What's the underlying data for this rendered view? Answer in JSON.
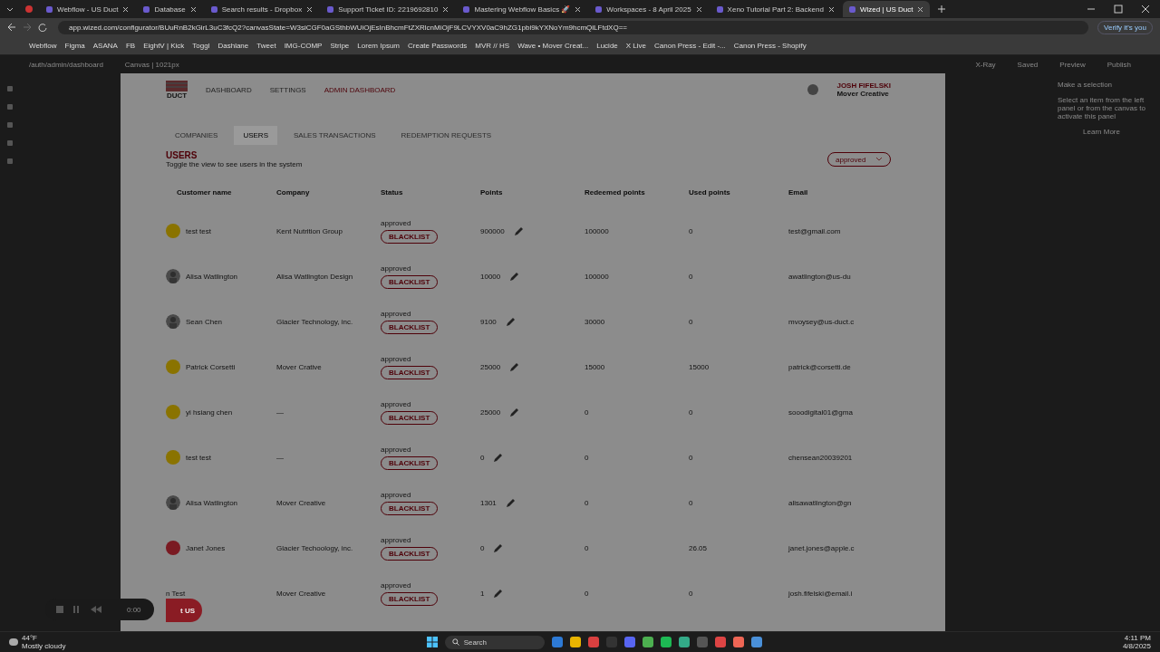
{
  "browser": {
    "tabs": [
      {
        "title": "Webflow - US Duct",
        "selected": false
      },
      {
        "title": "Database",
        "selected": false
      },
      {
        "title": "Search results - Dropbox",
        "selected": false
      },
      {
        "title": "Support Ticket ID: 2219692810",
        "selected": false
      },
      {
        "title": "Mastering Webflow Basics 🚀",
        "selected": false
      },
      {
        "title": "Workspaces - 8 April 2025",
        "selected": false
      },
      {
        "title": "Xeno Tutorial Part 2: Backend",
        "selected": false
      },
      {
        "title": "Wized | US Duct",
        "selected": true
      }
    ],
    "url": "app.wized.com/configurator/BUuRnB2kGirL3uC3fcQ2?canvasState=W3siCGF0aGSthbWUiOjEsInBhcmFtZXRlcnMiOjF9LCVYXV0aC9hZG1pbi9kYXNoYm9hcmQiLFtdXQ==",
    "profile": "Verify it's you",
    "bookmarks": [
      "Webflow",
      "Figma",
      "ASANA",
      "FB",
      "EightV | Kick",
      "Toggl",
      "Dashlane",
      "Tweet",
      "IMG-COMP",
      "Stripe",
      "Lorem Ipsum",
      "Create Passwords",
      "MVR // HS",
      "Wave • Mover Creat...",
      "Lucide",
      "X Live",
      "Canon Press - Edit -...",
      "Canon Press - Shopify"
    ]
  },
  "editor": {
    "path": "/auth/admin/dashboard",
    "canvas_size": "Canvas | 1021px",
    "actions": [
      "X-Ray",
      "Saved",
      "Preview",
      "Publish"
    ],
    "panel": {
      "title": "Make a selection",
      "text": "Select an item from the left panel or from the canvas to activate this panel",
      "link": "Learn More"
    }
  },
  "app": {
    "logo": "DUCT",
    "nav": [
      {
        "label": "DASHBOARD",
        "selected": false
      },
      {
        "label": "SETTINGS",
        "selected": false
      },
      {
        "label": "ADMIN DASHBOARD",
        "selected": true
      }
    ],
    "user": {
      "name": "JOSH FIFELSKI",
      "company": "Mover Creative"
    },
    "tabs": [
      {
        "label": "COMPANIES",
        "selected": false
      },
      {
        "label": "USERS",
        "selected": true
      },
      {
        "label": "SALES TRANSACTIONS",
        "selected": false
      },
      {
        "label": "REDEMPTION REQUESTS",
        "selected": false
      }
    ],
    "title": "USERS",
    "subtitle": "Toggle the view to see users in the system",
    "filter": "approved",
    "columns": [
      "Customer name",
      "Company",
      "Status",
      "Points",
      "Redeemed points",
      "Used points",
      "Email"
    ],
    "rows": [
      {
        "avatar": {
          "kind": "dot",
          "color": "#8a7300"
        },
        "name": "test test",
        "company": "Kent Nutrition Group",
        "status": "approved",
        "action": "BLACKLIST",
        "points": "900000",
        "redeemed": "100000",
        "used": "0",
        "email": "test@gmail.com"
      },
      {
        "name": "Alisa Watlington",
        "company": "Alisa Watlington Design",
        "status": "approved",
        "action": "BLACKLIST",
        "points": "10000",
        "redeemed": "100000",
        "used": "0",
        "email": "awatlington@us-du"
      },
      {
        "name": "Sean Chen",
        "company": "Glacier Technology, inc.",
        "status": "approved",
        "action": "BLACKLIST",
        "points": "9100",
        "redeemed": "30000",
        "used": "0",
        "email": "mvoysey@us-duct.c"
      },
      {
        "avatar": {
          "kind": "dot",
          "color": "#8a7300"
        },
        "name": "Patrick Corsetti",
        "company": "Mover Crative",
        "status": "approved",
        "action": "BLACKLIST",
        "points": "25000",
        "redeemed": "15000",
        "used": "15000",
        "email": "patrick@corsetti.de"
      },
      {
        "avatar": {
          "kind": "dot",
          "color": "#8a7300"
        },
        "name": "yi hsiang chen",
        "company": "—",
        "status": "approved",
        "action": "BLACKLIST",
        "points": "25000",
        "redeemed": "0",
        "used": "0",
        "email": "sooodigital01@gma"
      },
      {
        "avatar": {
          "kind": "dot",
          "color": "#8a7300"
        },
        "name": "test test",
        "company": "—",
        "status": "approved",
        "action": "BLACKLIST",
        "points": "0",
        "redeemed": "0",
        "used": "0",
        "email": "chensean20039201"
      },
      {
        "name": "Alisa Watlington",
        "company": "Mover Creative",
        "status": "approved",
        "action": "BLACKLIST",
        "points": "1301",
        "redeemed": "0",
        "used": "0",
        "email": "alisawatlington@gn"
      },
      {
        "avatar": {
          "kind": "dot",
          "color": "#7a1a22"
        },
        "name": "Janet Jones",
        "company": "Glacier Techoology, inc.",
        "status": "approved",
        "action": "BLACKLIST",
        "points": "0",
        "redeemed": "0",
        "used": "26.05",
        "email": "janet.jones@apple.c"
      },
      {
        "avatar": {
          "kind": "hidden"
        },
        "name": "n Test",
        "company": "Mover Creative",
        "status": "approved",
        "action": "BLACKLIST",
        "points": "1",
        "redeemed": "0",
        "used": "0",
        "email": "josh.fifelski@email.i"
      }
    ],
    "contact_button": "t US"
  },
  "recorder": {
    "time": "0:00"
  },
  "taskbar": {
    "weather": {
      "temp": "44°F",
      "text": "Mostly cloudy"
    },
    "search": "Search",
    "time": "4:11 PM",
    "date": "4/8/2025"
  }
}
